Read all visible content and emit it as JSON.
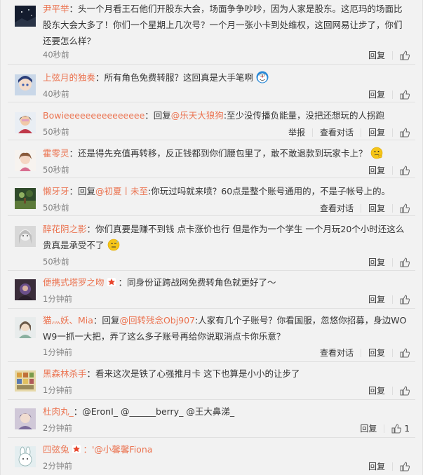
{
  "actions": {
    "reply": "回复",
    "report": "举报",
    "view_dialog": "查看对话"
  },
  "comments": [
    {
      "nick": "尹平举",
      "text": "：头一个月看王石他们开股东大会，场面争争吵吵，因为人家是股东。这厄玛的场面比股东大会大多了！你们一个星期上几次号？一个月一张小卡到处维权，这回网易让步了，你们还要怎么样？",
      "time": "40秒前"
    },
    {
      "nick": "上弦月的独奏",
      "text": "：所有角色免费转服？这回真是大手笔啊",
      "time": "40秒前"
    },
    {
      "nick": "Bowieeeeeeeeeeeeeee",
      "reply_prefix": "：回复",
      "mention": "@乐天大狼狗",
      "text": ":至少没传播负能量，没把还想玩的人拐跑",
      "time": "50秒前"
    },
    {
      "nick": "霍零灵",
      "text": "：还是得先充值再转移，反正钱都到你们腰包里了，敢不敢退款到玩家卡上？",
      "time": "50秒前"
    },
    {
      "nick": "懒牙牙",
      "reply_prefix": "：回复",
      "mention": "@初夏丨未至",
      "text": ":你玩过吗就来喷？60点是整个账号通用的，不是子帐号上的。",
      "time": "50秒前"
    },
    {
      "nick": "醉花阴之影",
      "text": "：你们真要是赚不到钱 点卡涨价也行 但是作为一个学生 一个月玩20个小时还这么贵真是承受不了",
      "time": "50秒前"
    },
    {
      "nick": "便携式塔罗之吻",
      "text": "：同身份证跨战网免费转角色就更好了～",
      "time": "1分钟前"
    },
    {
      "nick": "猫灬妖、Mia",
      "reply_prefix": "：回复",
      "mention": "@回转残念Obj907",
      "text": ":人家有几个子账号？你看国服，忽悠你招募，身边WOW9一抓一大把，弄了这么多子账号再给你说取消点卡你乐意？",
      "time": "1分钟前"
    },
    {
      "nick": "黑森林杀手",
      "text": "：看来这次是铁了心强推月卡 这下也算是小小的让步了",
      "time": "1分钟前"
    },
    {
      "nick": "杜肉丸_",
      "text": "：@EronI_ @______berry_ @王大鼻涕_",
      "time": "2分钟前",
      "likes": "1"
    },
    {
      "nick": "四弦兔",
      "text": "：'@小馨馨Fiona",
      "time": "2分钟前"
    }
  ]
}
